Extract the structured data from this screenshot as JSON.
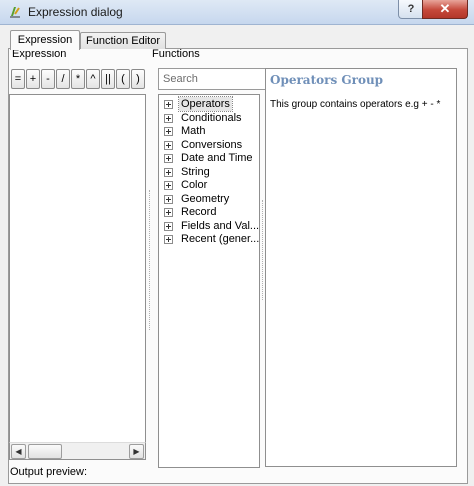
{
  "window": {
    "title": "Expression dialog",
    "help_button": "?",
    "close_button": "✕"
  },
  "tabs": [
    {
      "label": "Expression"
    },
    {
      "label": "Function Editor"
    }
  ],
  "sections": {
    "expression_label": "Expression",
    "functions_label": "Functions"
  },
  "operators": [
    "=",
    "+",
    "-",
    "/",
    "*",
    "^",
    "||",
    "(",
    ")"
  ],
  "search": {
    "placeholder": "Search",
    "value": ""
  },
  "function_groups": [
    {
      "label": "Operators",
      "selected": true
    },
    {
      "label": "Conditionals"
    },
    {
      "label": "Math"
    },
    {
      "label": "Conversions"
    },
    {
      "label": "Date and Time"
    },
    {
      "label": "String"
    },
    {
      "label": "Color"
    },
    {
      "label": "Geometry"
    },
    {
      "label": "Record"
    },
    {
      "label": "Fields and Val..."
    },
    {
      "label": "Recent (gener..."
    }
  ],
  "help": {
    "title": "Operators Group",
    "body": "This group contains operators e.g + - *"
  },
  "output_preview_label": "Output preview:",
  "icons": {
    "app": "qgis-expression-icon",
    "scroll_left": "arrow-left-icon",
    "scroll_right": "arrow-right-icon"
  }
}
